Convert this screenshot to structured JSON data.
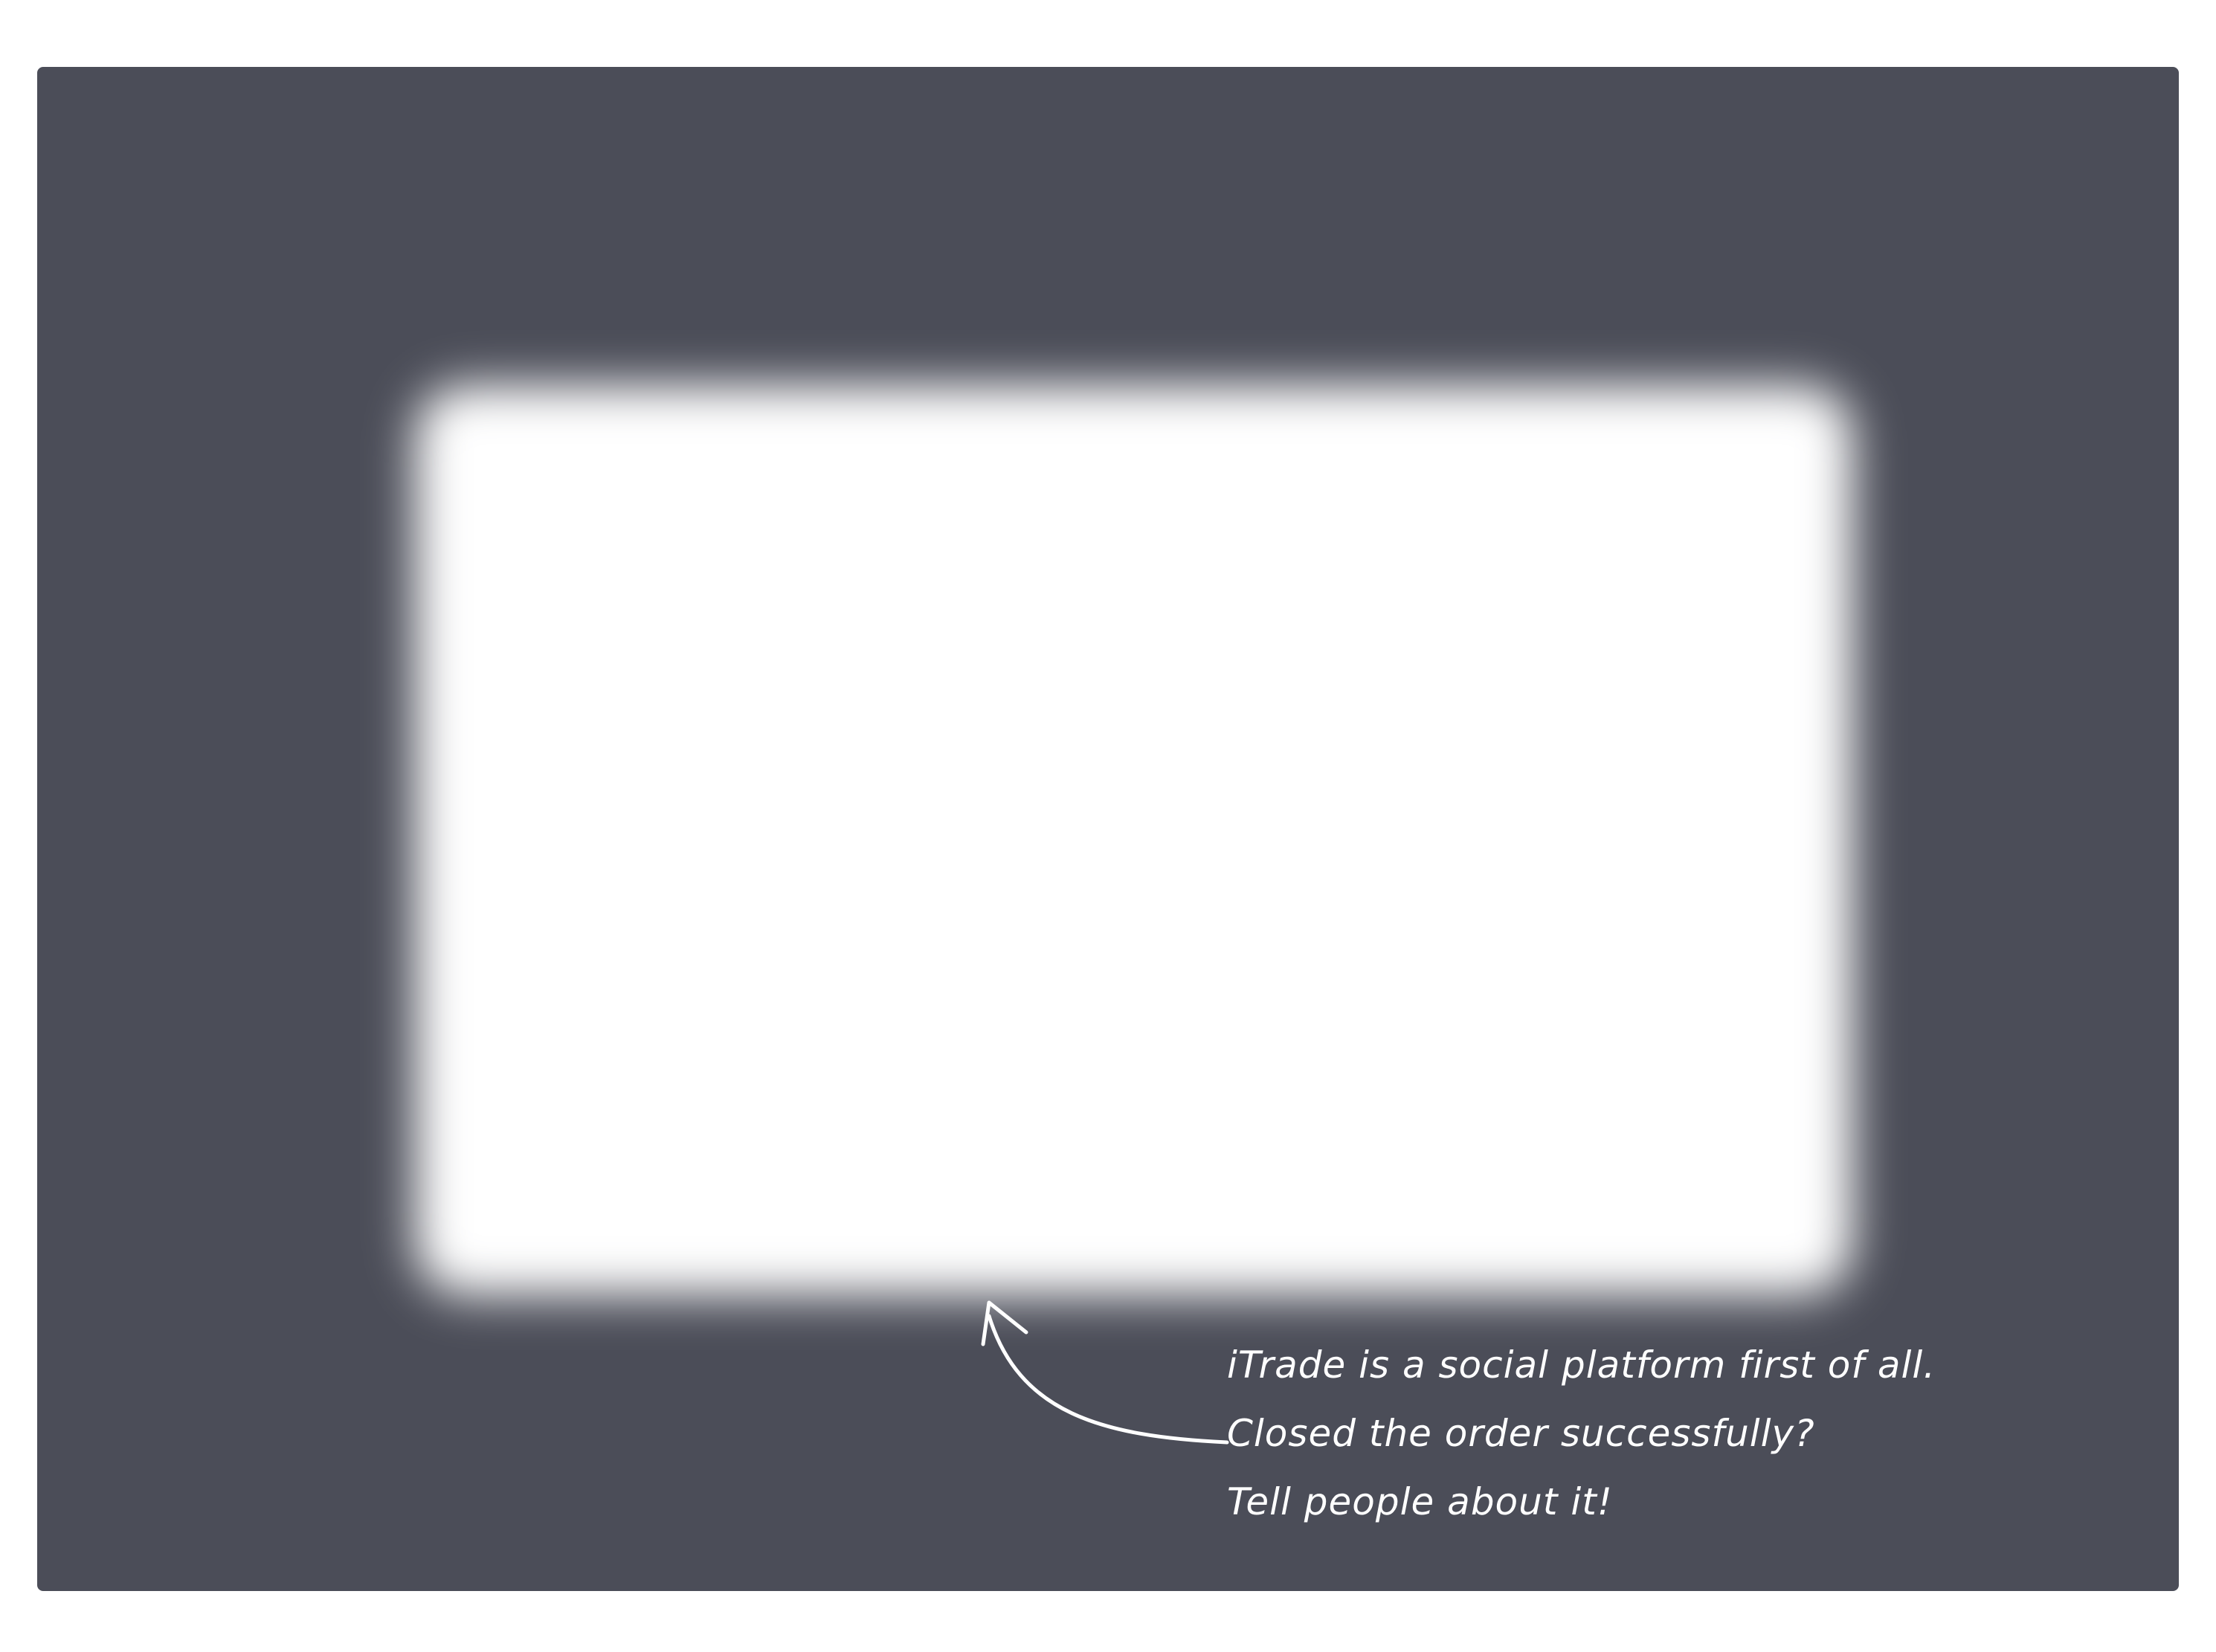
{
  "colors": {
    "page_background": "#ffffff",
    "panel_background": "#4b4d58",
    "highlight": "#ffffff",
    "annotation": "#ffffff"
  },
  "annotation": {
    "lines": [
      "iTrade is a social platform first of all.",
      "Closed the order successfully?",
      "Tell people about it!"
    ]
  },
  "icons": {
    "pointer": "curved-arrow-icon"
  }
}
